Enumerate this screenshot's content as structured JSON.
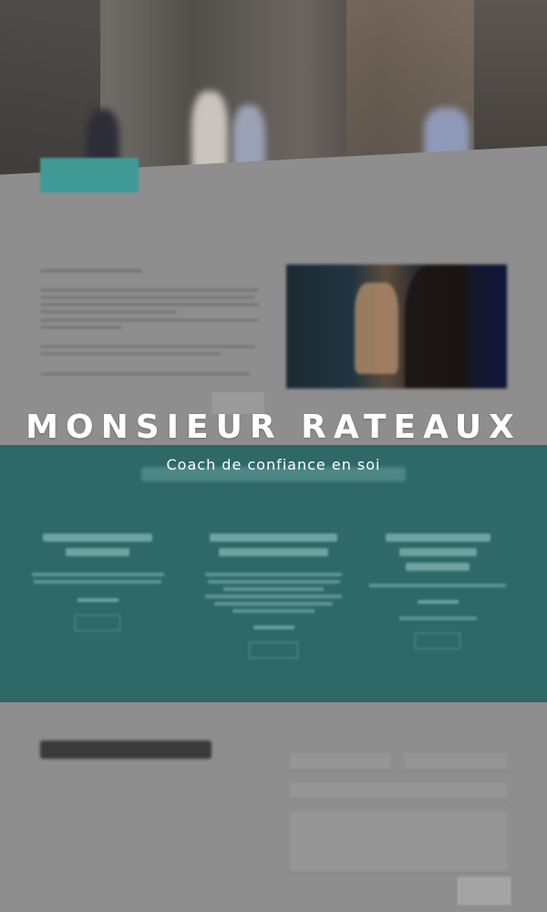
{
  "overlay": {
    "title": "MONSIEUR RATEAUX",
    "subtitle": "Coach de confiance en soi"
  },
  "colors": {
    "teal": "#2e6867",
    "accent": "#3f9a95",
    "background": "#8e8e8e"
  }
}
